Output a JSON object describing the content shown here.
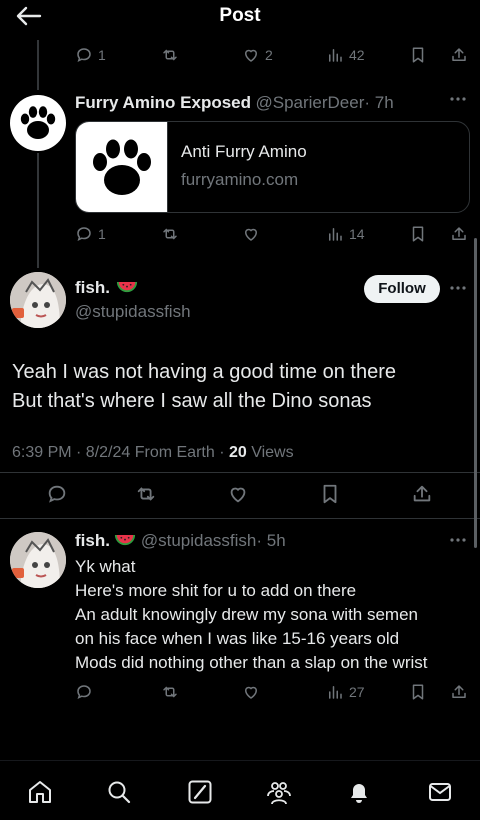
{
  "header": {
    "title": "Post"
  },
  "prev_tweet": {
    "replies": "1",
    "likes": "2",
    "views": "42"
  },
  "quoted_tweet": {
    "name": "Furry Amino Exposed",
    "handle": "@SparierDeer",
    "time": "· 7h",
    "card_title": "Anti Furry Amino",
    "card_domain": "furryamino.com",
    "replies": "1",
    "views": "14"
  },
  "main_tweet": {
    "name": "fish.",
    "handle": "@stupidassfish",
    "follow_label": "Follow",
    "text_line1": "Yeah I was not having a good time on there",
    "text_line2": "But that's where I saw all the Dino sonas",
    "meta_time": "6:39 PM · 8/2/24 From Earth · ",
    "meta_views_count": "20",
    "meta_views_label": " Views"
  },
  "reply_tweet": {
    "name": "fish.",
    "handle": "@stupidassfish",
    "time": "· 5h",
    "lines": [
      "Yk what",
      "Here's more shit for u to add on there",
      "An adult knowingly drew my sona with semen",
      "on his face when I was like 15-16 years old",
      "Mods did nothing other than a slap on the wrist"
    ],
    "views": "27"
  },
  "colors": {
    "background": "#000000",
    "text": "#e7e9ea",
    "muted": "#71767b",
    "divider": "#2f3336"
  },
  "icons": [
    "back-arrow-icon",
    "reply-icon",
    "retweet-icon",
    "like-icon",
    "views-icon",
    "bookmark-icon",
    "share-icon",
    "more-icon",
    "home-icon",
    "search-icon",
    "grok-icon",
    "communities-icon",
    "notifications-icon",
    "messages-icon"
  ]
}
